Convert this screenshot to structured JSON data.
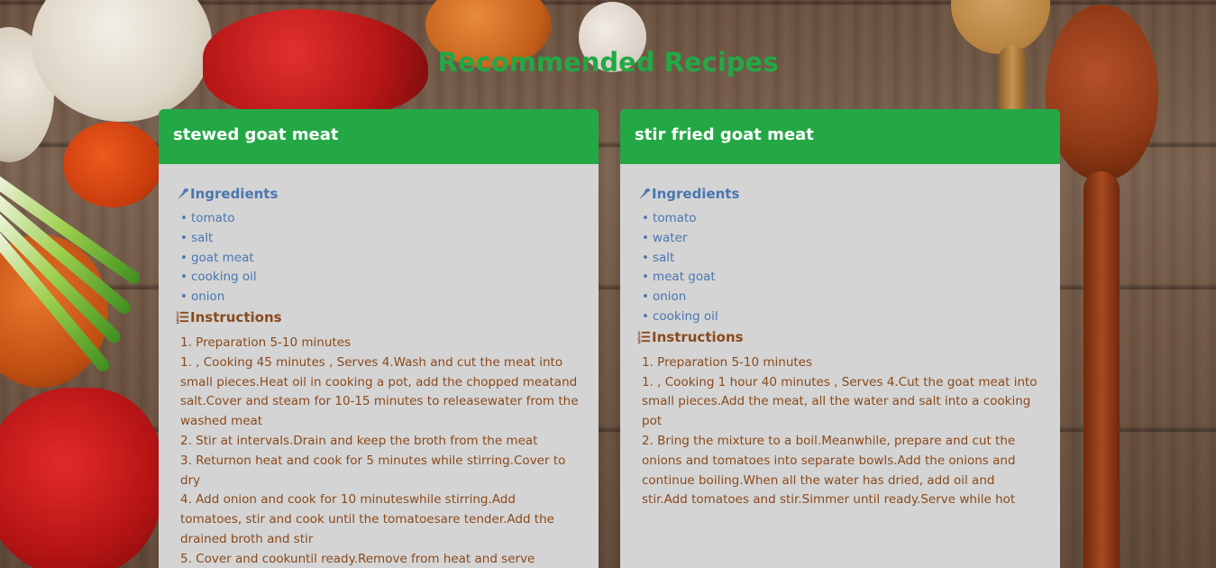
{
  "page": {
    "title": "Recommended Recipes"
  },
  "colors": {
    "accent_green": "#23a845",
    "ingredients_blue": "#4a76b0",
    "instructions_brown": "#8a4a1c",
    "card_background": "#d4d4d4"
  },
  "recipes": [
    {
      "name": "stewed goat meat",
      "ingredients_heading": "Ingredients",
      "ingredients_icon": "carrot-icon",
      "ingredients": [
        "tomato",
        "salt",
        "goat meat",
        "cooking oil",
        "onion"
      ],
      "instructions_heading": "Instructions",
      "instructions_icon": "list-ol-icon",
      "instructions": [
        "1. Preparation 5-10 minutes",
        "1. , Cooking 45 minutes , Serves 4.Wash and cut the meat into small pieces.Heat oil in cooking a pot, add the chopped meatand salt.Cover and steam for 10-15 minutes to releasewater from the washed meat",
        "2. Stir at intervals.Drain and keep the broth from the meat",
        "3. Returnon heat and cook for 5 minutes while stirring.Cover to dry",
        "4. Add onion and cook for 10 minuteswhile stirring.Add tomatoes, stir and cook until the tomatoesare tender.Add the drained broth and stir",
        "5. Cover and cookuntil ready.Remove from heat and serve"
      ]
    },
    {
      "name": "stir fried goat meat",
      "ingredients_heading": "Ingredients",
      "ingredients_icon": "carrot-icon",
      "ingredients": [
        "tomato",
        "water",
        "salt",
        "meat goat",
        "onion",
        "cooking oil"
      ],
      "instructions_heading": "Instructions",
      "instructions_icon": "list-ol-icon",
      "instructions": [
        "1. Preparation 5-10 minutes",
        "1. , Cooking 1 hour 40 minutes , Serves 4.Cut the goat meat into small pieces.Add the meat, all the water and salt into a cooking pot",
        "2. Bring the mixture to a boil.Meanwhile, prepare and cut the onions and tomatoes into separate bowls.Add the onions and continue boiling.When all the water has dried, add oil and stir.Add tomatoes and stir.Simmer until ready.Serve while hot"
      ]
    }
  ]
}
